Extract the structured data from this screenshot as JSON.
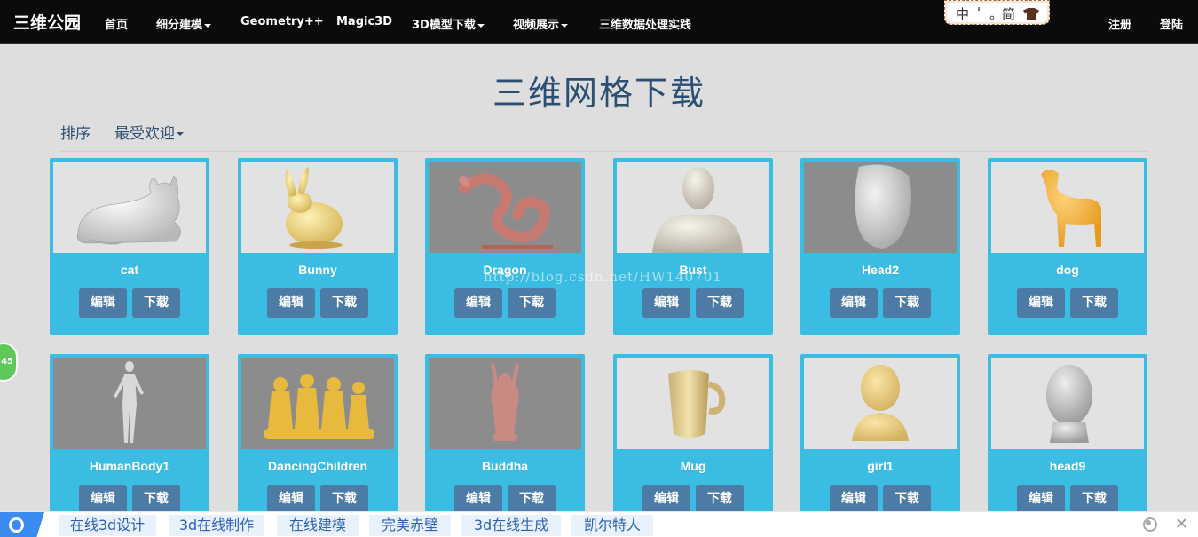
{
  "navbar": {
    "brand": "三维公园",
    "items": [
      "首页",
      "细分建模",
      "Geometry++",
      "Magic3D",
      "3D模型下载",
      "视频展示",
      "三维数据处理实践"
    ],
    "right": [
      "注册",
      "登陆"
    ]
  },
  "ime": {
    "chars": [
      "中",
      "'",
      "。",
      "简"
    ]
  },
  "page": {
    "title": "三维网格下载",
    "sort_label": "排序",
    "sort_value": "最受欢迎"
  },
  "buttons": {
    "edit": "编辑",
    "download": "下载"
  },
  "models": [
    {
      "name": "cat",
      "bg": "#e2e2e2"
    },
    {
      "name": "Bunny",
      "bg": "#e2e2e2"
    },
    {
      "name": "Dragon",
      "bg": "#8c8c8c"
    },
    {
      "name": "Bust",
      "bg": "#e2e2e2"
    },
    {
      "name": "Head2",
      "bg": "#8c8c8c"
    },
    {
      "name": "dog",
      "bg": "#e2e2e2"
    },
    {
      "name": "HumanBody1",
      "bg": "#8c8c8c"
    },
    {
      "name": "DancingChildren",
      "bg": "#8c8c8c"
    },
    {
      "name": "Buddha",
      "bg": "#8c8c8c"
    },
    {
      "name": "Mug",
      "bg": "#e2e2e2"
    },
    {
      "name": "girl1",
      "bg": "#e2e2e2"
    },
    {
      "name": "head9",
      "bg": "#e2e2e2"
    }
  ],
  "watermark": "http://blog.csdn.net/HW140701",
  "float_badge": "45",
  "bottom_bar": {
    "chips": [
      "在线3d设计",
      "3d在线制作",
      "在线建模",
      "完美赤壁",
      "3d在线生成",
      "凯尔特人"
    ]
  },
  "colors": {
    "navbar": "#0b0b0b",
    "accent_card": "#3bbde3",
    "button": "#4c7ba6",
    "title": "#2a4f72",
    "search_blue": "#3a8bf0"
  }
}
